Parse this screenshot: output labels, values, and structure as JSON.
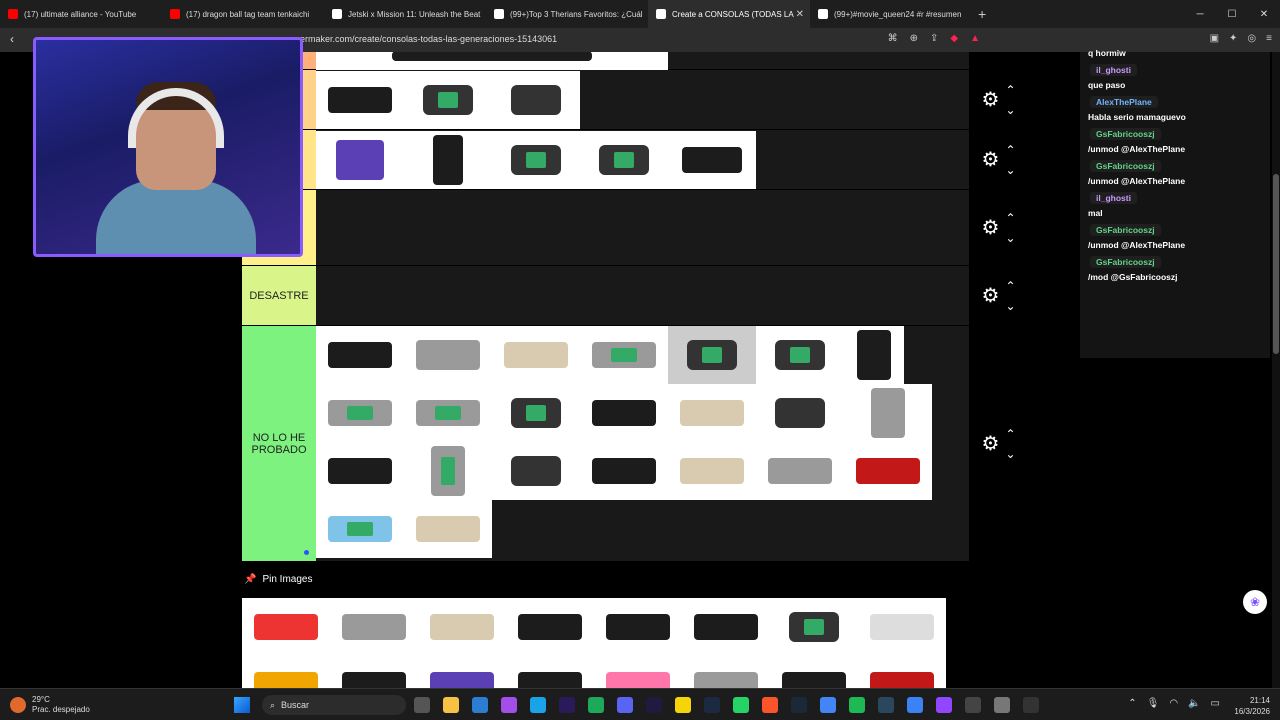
{
  "tabs": [
    {
      "label": "(17) ultimate alliance - YouTube",
      "color": "#ff0000"
    },
    {
      "label": "(17) dragon ball tag team tenkaichi",
      "color": "#ff0000"
    },
    {
      "label": "Jetski x Mission 11: Unleash the Beat",
      "color": "#ffffff"
    },
    {
      "label": "(99+)Top 3 Therians Favoritos: ¿Cuál",
      "color": "#ffffff"
    },
    {
      "label": "Create a CONSOLAS (TODAS LA",
      "color": "#ffffff"
    },
    {
      "label": "(99+)#movie_queen24 #r #resumen",
      "color": "#ffffff"
    }
  ],
  "url": "ermaker.com/create/consolas-todas-las-generaciones-15143061",
  "tiers": [
    {
      "label": "",
      "color": "#ffb07a"
    },
    {
      "label": "",
      "color": "#ffd28a"
    },
    {
      "label": "",
      "color": "#fff08a"
    },
    {
      "label": "DESASTRE",
      "color": "#d9f58a"
    },
    {
      "label": "NO LO HE PROBADO",
      "color": "#7ef27e"
    }
  ],
  "pin_label": "Pin Images",
  "chat": [
    {
      "user": "",
      "text": "q hormiw"
    },
    {
      "user": "il_ghosti",
      "color": "#c89bff",
      "text": "que paso"
    },
    {
      "user": "AlexThePlane",
      "color": "#6fb4ff",
      "text": "Habla serio mamaguevo"
    },
    {
      "user": "GsFabricooszj",
      "color": "#62d38b",
      "text": "/unmod @AlexThePlane"
    },
    {
      "user": "GsFabricooszj",
      "color": "#62d38b",
      "text": "/unmod @AlexThePlane"
    },
    {
      "user": "il_ghosti",
      "color": "#c89bff",
      "text": "mal"
    },
    {
      "user": "GsFabricooszj",
      "color": "#62d38b",
      "text": "/unmod @AlexThePlane"
    },
    {
      "user": "GsFabricooszj",
      "color": "#62d38b",
      "text": "/mod @GsFabricooszj"
    }
  ],
  "taskbar": {
    "temp": "29°C",
    "weather": "Prac. despejado",
    "search": "Buscar",
    "time": "21:14",
    "date": "16/3/2026"
  }
}
